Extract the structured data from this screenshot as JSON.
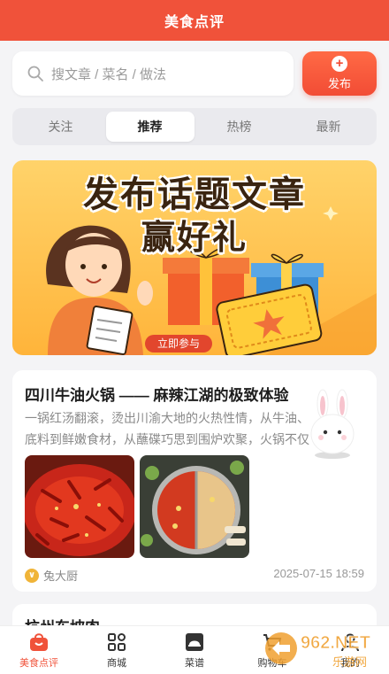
{
  "app": {
    "title": "美食点评"
  },
  "search": {
    "placeholder": "搜文章 / 菜名 / 做法"
  },
  "publish": {
    "label": "发布"
  },
  "tabs": [
    {
      "label": "关注",
      "active": false
    },
    {
      "label": "推荐",
      "active": true
    },
    {
      "label": "热榜",
      "active": false
    },
    {
      "label": "最新",
      "active": false
    }
  ],
  "banner": {
    "line1": "发布话题文章",
    "line2": "赢好礼",
    "cta": "立即参与"
  },
  "articles": [
    {
      "title": "四川牛油火锅 —— 麻辣江湖的极致体验",
      "excerpt": "一锅红汤翻滚，烫出川渝大地的火热性情，从牛油、底料到鲜嫩食材，从蘸碟巧思到围炉欢聚，火锅不仅是味",
      "author": "兔大厨",
      "date": "2025-07-15 18:59"
    },
    {
      "title": "杭州东坡肉"
    }
  ],
  "bottom_nav": [
    {
      "label": "美食点评",
      "icon": "bag-icon",
      "active": true
    },
    {
      "label": "商城",
      "icon": "grid-icon",
      "active": false
    },
    {
      "label": "菜谱",
      "icon": "cloche-icon",
      "active": false
    },
    {
      "label": "购物车",
      "icon": "cart-icon",
      "active": false
    },
    {
      "label": "我的",
      "icon": "user-icon",
      "active": false
    }
  ],
  "colors": {
    "brand": "#f0523a",
    "banner": "#ffb43a"
  },
  "watermark": {
    "text": "962.NET",
    "subtext": "乐游网"
  }
}
